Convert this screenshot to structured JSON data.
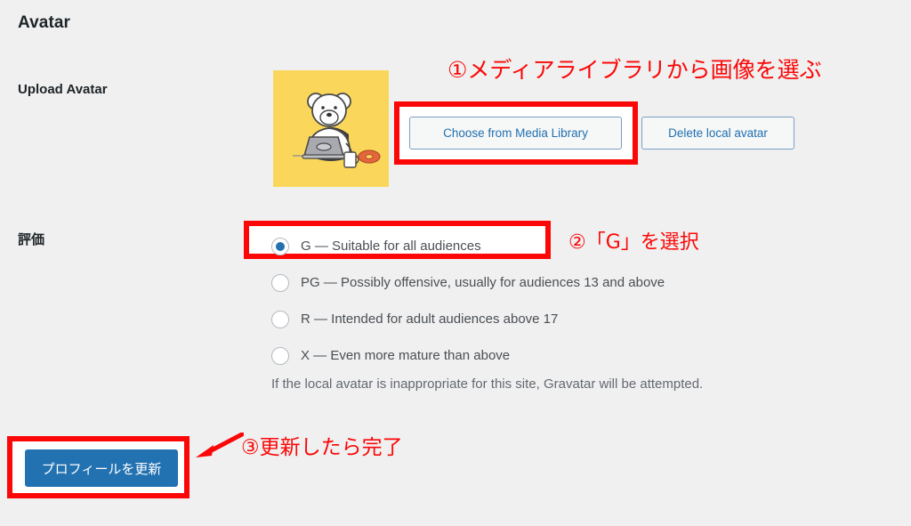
{
  "section": {
    "title": "Avatar"
  },
  "rows": {
    "upload_avatar": {
      "label": "Upload Avatar",
      "avatar_alt": "polar-bear-at-laptop-avatar",
      "avatar_bg": "#fad75a",
      "buttons": {
        "choose_from_media_library": "Choose from Media Library",
        "delete_local_avatar": "Delete local avatar"
      }
    },
    "rating": {
      "label": "評価",
      "options": [
        {
          "value": "G",
          "label": "G — Suitable for all audiences",
          "checked": true
        },
        {
          "value": "PG",
          "label": "PG — Possibly offensive, usually for audiences 13 and above",
          "checked": false
        },
        {
          "value": "R",
          "label": "R — Intended for adult audiences above 17",
          "checked": false
        },
        {
          "value": "X",
          "label": "X — Even more mature than above",
          "checked": false
        }
      ],
      "help_text": "If the local avatar is inappropriate for this site, Gravatar will be attempted."
    }
  },
  "submit": {
    "update_profile_label": "プロフィールを更新"
  },
  "annotations": {
    "accent_color": "#fb0707",
    "step1": "①メディアライブラリから画像を選ぶ",
    "step2": "②「G」を選択",
    "step3": "③更新したら完了",
    "arrow_icon": "arrow-left-icon"
  },
  "colors": {
    "page_background": "#f0f0f0",
    "link_blue": "#2271b1",
    "heading": "#1d2327",
    "muted_text": "#646970",
    "annotation_red": "#fb0707"
  }
}
